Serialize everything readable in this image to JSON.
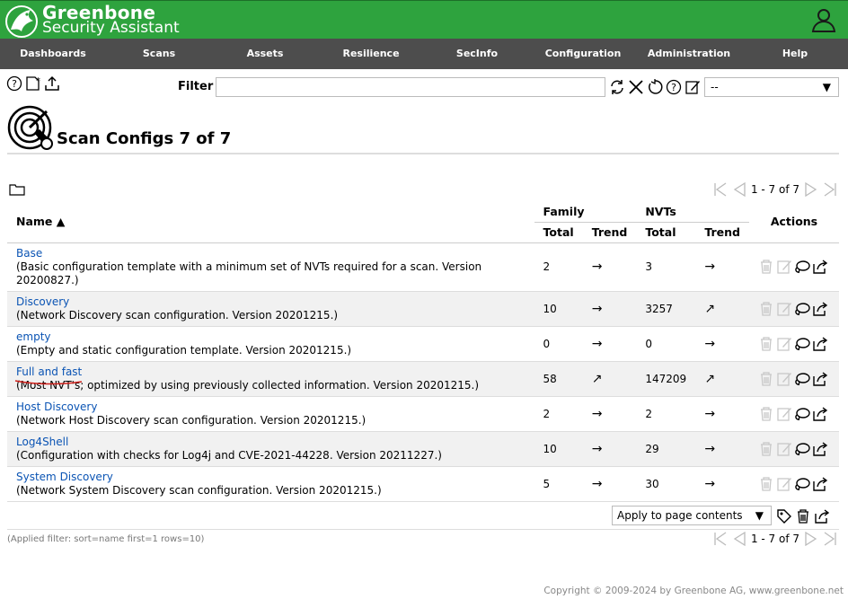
{
  "brand": {
    "line1": "Greenbone",
    "line2": "Security Assistant"
  },
  "nav": [
    "Dashboards",
    "Scans",
    "Assets",
    "Resilience",
    "SecInfo",
    "Configuration",
    "Administration",
    "Help"
  ],
  "toolbar": {
    "filter_label": "Filter",
    "filter_value": "",
    "filter_select": "--"
  },
  "page": {
    "title": "Scan Configs 7 of 7"
  },
  "pager": {
    "range": "1 - 7 of 7"
  },
  "table": {
    "headers": {
      "name": "Name ▲",
      "family": "Family",
      "nvts": "NVTs",
      "actions": "Actions",
      "total": "Total",
      "trend": "Trend"
    },
    "rows": [
      {
        "name": "Base",
        "comment": "(Basic configuration template with a minimum set of NVTs required for a scan. Version 20200827.)",
        "family_total": "2",
        "family_trend": "→",
        "nvts_total": "3",
        "nvts_trend": "→"
      },
      {
        "name": "Discovery",
        "comment": "(Network Discovery scan configuration. Version 20201215.)",
        "family_total": "10",
        "family_trend": "→",
        "nvts_total": "3257",
        "nvts_trend": "↗"
      },
      {
        "name": "empty",
        "comment": "(Empty and static configuration template. Version 20201215.)",
        "family_total": "0",
        "family_trend": "→",
        "nvts_total": "0",
        "nvts_trend": "→"
      },
      {
        "name": "Full and fast",
        "comment": "(Most NVT's; optimized by using previously collected information. Version 20201215.)",
        "family_total": "58",
        "family_trend": "↗",
        "nvts_total": "147209",
        "nvts_trend": "↗"
      },
      {
        "name": "Host Discovery",
        "comment": "(Network Host Discovery scan configuration. Version 20201215.)",
        "family_total": "2",
        "family_trend": "→",
        "nvts_total": "2",
        "nvts_trend": "→"
      },
      {
        "name": "Log4Shell",
        "comment": "(Configuration with checks for Log4j and CVE-2021-44228. Version 20211227.)",
        "family_total": "10",
        "family_trend": "→",
        "nvts_total": "29",
        "nvts_trend": "→"
      },
      {
        "name": "System Discovery",
        "comment": "(Network System Discovery scan configuration. Version 20201215.)",
        "family_total": "5",
        "family_trend": "→",
        "nvts_total": "30",
        "nvts_trend": "→"
      }
    ]
  },
  "bulk": {
    "select": "Apply to page contents"
  },
  "footer": {
    "applied_filter": "(Applied filter: sort=name first=1 rows=10)",
    "copyright": "Copyright © 2009-2024 by Greenbone AG, www.greenbone.net"
  },
  "colors": {
    "brand_green": "#2ea33e",
    "nav_gray": "#4d4d4d",
    "link_blue": "#0b54b4"
  },
  "icons": [
    "greenbone-logo-icon",
    "user-icon",
    "help-icon",
    "new-icon",
    "upload-icon",
    "refresh-icon",
    "clear-icon",
    "reset-icon",
    "filter-help-icon",
    "edit-filter-icon",
    "scan-config-icon",
    "folder-icon",
    "first-page-icon",
    "previous-page-icon",
    "next-page-icon",
    "last-page-icon",
    "delete-icon",
    "edit-icon",
    "clone-icon",
    "export-icon",
    "tag-icon"
  ]
}
